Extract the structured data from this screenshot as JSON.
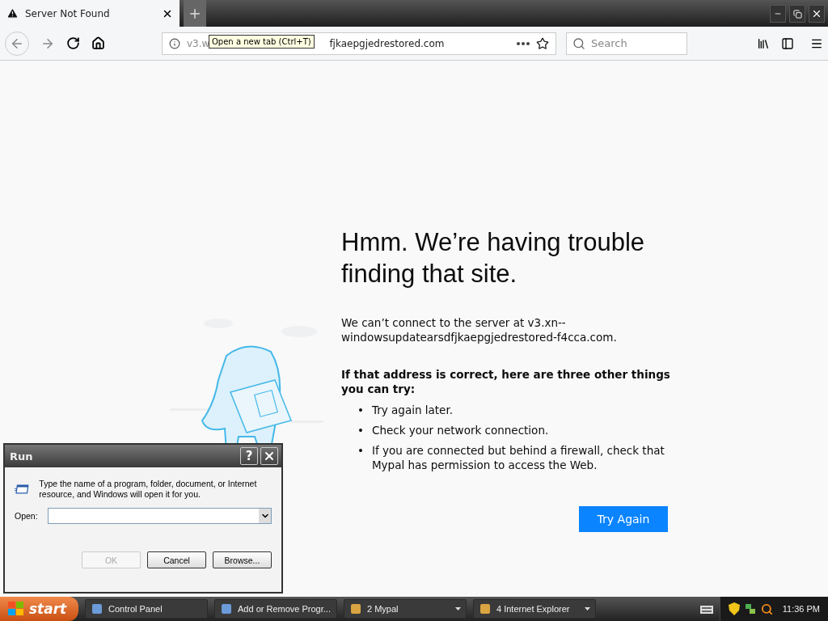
{
  "browser": {
    "tab": {
      "title": "Server Not Found",
      "selected": true
    },
    "tooltip": "Open a new tab (Ctrl+T)",
    "address_bar": {
      "text_before_tooltip": "v3.w",
      "text_after_tooltip": "fjkaepgjedrestored.com"
    },
    "search": {
      "placeholder": "Search"
    }
  },
  "error_page": {
    "heading": "Hmm. We’re having trouble finding that site.",
    "message": "We can’t connect to the server at v3.xn--windowsupdatearsdfjkaepgjedrestored-f4cca.com.",
    "suggestions_title": "If that address is correct, here are three other things you can try:",
    "suggestions": [
      {
        "bullet": "•",
        "text": "Try again later."
      },
      {
        "bullet": "•",
        "text": "Check your network connection."
      },
      {
        "bullet": "•",
        "text": "If you are connected but behind a firewall, check that Mypal has permission to access the Web."
      }
    ],
    "button": "Try Again"
  },
  "run_dialog": {
    "title": "Run",
    "help": "?",
    "description": "Type the name of a program, folder, document, or Internet resource, and Windows will open it for you.",
    "open_label": "Open:",
    "buttons": [
      {
        "label": "OK",
        "disabled": true
      },
      {
        "label": "Cancel",
        "disabled": false
      },
      {
        "label": "Browse...",
        "disabled": false
      }
    ]
  },
  "taskbar": {
    "start": "start",
    "items": [
      {
        "label": "Control Panel",
        "kind": "single"
      },
      {
        "label": "Add or Remove Progr...",
        "kind": "single"
      },
      {
        "label": "2 Mypal",
        "kind": "group"
      },
      {
        "label": "4 Internet Explorer",
        "kind": "group"
      }
    ],
    "clock": "11:36 PM"
  }
}
